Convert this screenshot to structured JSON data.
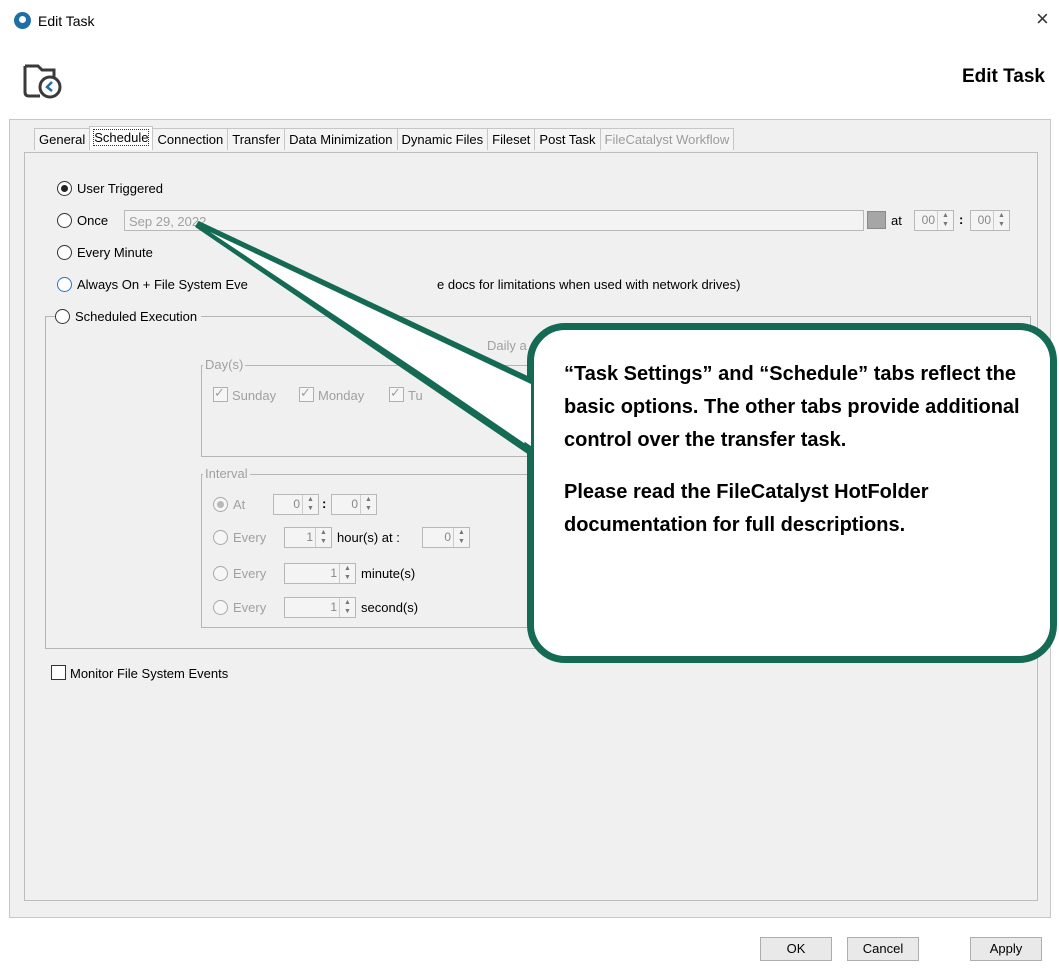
{
  "window": {
    "title": "Edit Task",
    "close_glyph": "×",
    "header_title": "Edit Task"
  },
  "tabs": [
    {
      "label": "General",
      "state": "normal"
    },
    {
      "label": "Schedule",
      "state": "active"
    },
    {
      "label": "Connection",
      "state": "normal"
    },
    {
      "label": "Transfer",
      "state": "normal"
    },
    {
      "label": "Data Minimization",
      "state": "normal"
    },
    {
      "label": "Dynamic Files",
      "state": "normal"
    },
    {
      "label": "Fileset",
      "state": "normal"
    },
    {
      "label": "Post Task",
      "state": "normal"
    },
    {
      "label": "FileCatalyst Workflow",
      "state": "disabled"
    }
  ],
  "schedule": {
    "user_triggered": "User Triggered",
    "once": "Once",
    "once_date": "Sep 29, 2022",
    "at": "at",
    "once_hour": "00",
    "once_minute": "00",
    "time_sep": ":",
    "every_minute": "Every Minute",
    "always_on": "Always On + File System Eve",
    "always_on_tail": "e docs for limitations when used with network drives)",
    "scheduled_execution": "Scheduled Execution",
    "daily_label": "Daily a",
    "days_group": "Day(s)",
    "days": [
      "Sunday",
      "Monday",
      "Tu"
    ],
    "interval_group": "Interval",
    "interval_at": "At",
    "at_hour": "0",
    "at_minute": "0",
    "every": "Every",
    "hours_value": "1",
    "hours_label": "hour(s) at :",
    "hours_minute": "0",
    "minutes_value": "1",
    "minutes_label": "minute(s)",
    "seconds_value": "1",
    "seconds_label": "second(s)",
    "selected_option": "User Triggered"
  },
  "monitor_events": {
    "label": "Monitor File System Events",
    "checked": false
  },
  "buttons": {
    "ok": "OK",
    "cancel": "Cancel",
    "apply": "Apply"
  },
  "callout": {
    "paragraph1": "“Task Settings” and “Schedule” tabs reflect the basic options.  The other tabs provide additional control over the transfer task.",
    "paragraph2": "Please read the FileCatalyst HotFolder documentation for full descriptions."
  },
  "colors": {
    "callout_border": "#146a52",
    "callout_fill": "#ffffff",
    "radio_accent": "#2a72c9"
  },
  "icons": {
    "app": "clock-folder-icon",
    "close": "close-icon",
    "calendar": "calendar-icon"
  }
}
